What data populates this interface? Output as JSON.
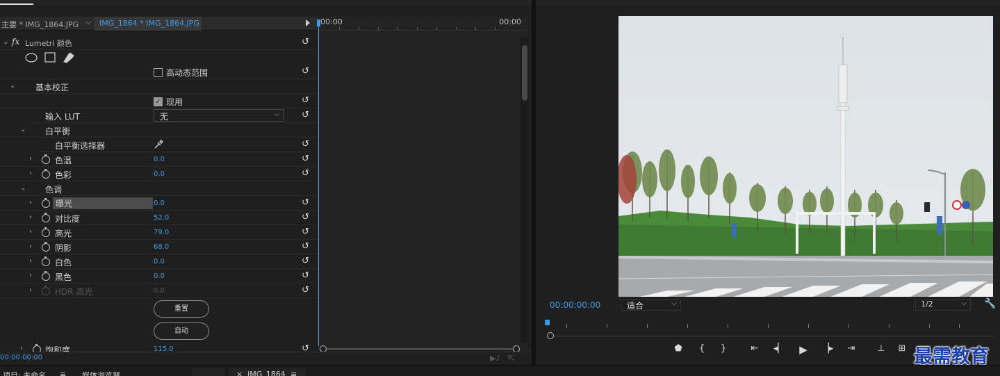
{
  "effect_controls": {
    "source_master": "主要 * IMG_1864.JPG",
    "source_clip": "IMG_1864 * IMG_1864.JPG",
    "ruler_start": "00:00",
    "ruler_end": "00:00",
    "fx_label": "fx",
    "effect_name": "Lumetri 颜色",
    "hdr_label": "高动态范围",
    "basic_correction": "基本校正",
    "enable_label": "现用",
    "input_lut_label": "输入 LUT",
    "input_lut_value": "无",
    "white_balance": "白平衡",
    "wb_selector": "白平衡选择器",
    "temperature_label": "色温",
    "temperature_value": "0.0",
    "tint_label": "色彩",
    "tint_value": "0.0",
    "tone": "色调",
    "exposure_label": "曝光",
    "exposure_value": "0.0",
    "contrast_label": "对比度",
    "contrast_value": "52.0",
    "highlights_label": "高光",
    "highlights_value": "79.0",
    "shadows_label": "阴影",
    "shadows_value": "68.0",
    "whites_label": "白色",
    "whites_value": "0.0",
    "blacks_label": "黑色",
    "blacks_value": "0.0",
    "hdr_highlights_label": "HDR 高光",
    "hdr_highlights_value": "0.0",
    "reset_button": "重置",
    "auto_button": "自动",
    "saturation_label": "饱和度",
    "saturation_value": "115.0",
    "footer_timecode": "00:00:00:00"
  },
  "program_monitor": {
    "timecode": "00:00:00:00",
    "fit": "适合",
    "resolution": "1/2"
  },
  "bottom_bar": {
    "project": "项目: 未命名",
    "media_browser": "媒体浏览器",
    "sequence_tab": "IMG_1864"
  },
  "watermark": "最需教育",
  "accent_color": "#3e9be8"
}
